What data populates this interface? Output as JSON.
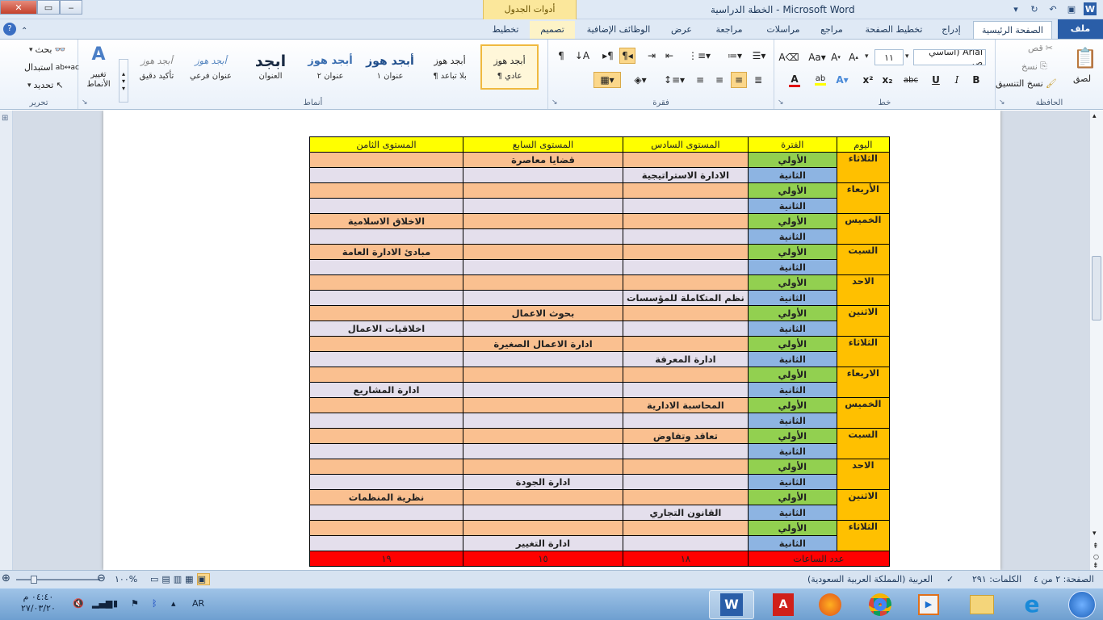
{
  "window": {
    "title": "الخطة الدراسية  -  Microsoft Word",
    "contextual_group": "أدوات الجدول",
    "buttons": {
      "close": "✕",
      "maximize": "▭",
      "minimize": "‒"
    }
  },
  "tabs": {
    "file": "ملف",
    "home": "الصفحة الرئيسية",
    "insert": "إدراج",
    "page_layout": "تخطيط الصفحة",
    "references": "مراجع",
    "mailings": "مراسلات",
    "review": "مراجعة",
    "view": "عرض",
    "addins": "الوظائف الإضافية",
    "design": "تصميم",
    "layout": "تخطيط"
  },
  "ribbon": {
    "clipboard": {
      "label": "الحافظة",
      "paste": "لصق",
      "cut": "قص",
      "copy": "نسخ",
      "format_painter": "نسخ التنسيق"
    },
    "font": {
      "label": "خط",
      "font_name": "Arial (أساسي ص",
      "font_size": "١١",
      "bold": "B",
      "italic": "I",
      "underline": "U",
      "strike": "abc",
      "sub": "x₂",
      "sup": "x²",
      "font_color": "#e00000",
      "highlight_color": "#ffff00"
    },
    "paragraph": {
      "label": "فقرة"
    },
    "styles": {
      "label": "أنماط",
      "items": [
        {
          "sample": "أبجد هوز",
          "name": "¶ عادي"
        },
        {
          "sample": "أبجد هوز",
          "name": "¶ بلا تباعد"
        },
        {
          "sample": "أبجد هوز",
          "name": "عنوان ١"
        },
        {
          "sample": "أبجد هوز",
          "name": "عنوان ٢"
        },
        {
          "sample": "ابجد",
          "name": "العنوان"
        },
        {
          "sample": "أبجد هوز",
          "name": "عنوان فرعي"
        },
        {
          "sample": "أبجد هوز",
          "name": "تأكيد دقيق"
        }
      ],
      "change_styles": "تغيير الأنماط"
    },
    "editing": {
      "label": "تحرير",
      "find": "بحث",
      "replace": "استبدال",
      "select": "تحديد"
    }
  },
  "table": {
    "headers": [
      "اليوم",
      "الفترة",
      "المستوى السادس",
      "المستوى السابع",
      "المستوى الثامن"
    ],
    "days": [
      {
        "day": "الثلاثاء",
        "rows": [
          [
            "الأولي",
            "",
            "قضايا معاصرة",
            ""
          ],
          [
            "الثانية",
            "الادارة الاستراتيجية",
            "",
            ""
          ]
        ]
      },
      {
        "day": "الأربعاء",
        "rows": [
          [
            "الأولي",
            "",
            "",
            ""
          ],
          [
            "الثانية",
            "",
            "",
            ""
          ]
        ]
      },
      {
        "day": "الخميس",
        "rows": [
          [
            "الأولي",
            "",
            "",
            "الاخلاق الاسلامية"
          ],
          [
            "الثانية",
            "",
            "",
            ""
          ]
        ]
      },
      {
        "day": "السبت",
        "rows": [
          [
            "الأولي",
            "",
            "",
            "مبادئ الادارة العامة"
          ],
          [
            "الثانية",
            "",
            "",
            ""
          ]
        ]
      },
      {
        "day": "الاحد",
        "rows": [
          [
            "الأولي",
            "",
            "",
            ""
          ],
          [
            "الثانية",
            "نظم المتكاملة للمؤسسات",
            "",
            ""
          ]
        ]
      },
      {
        "day": "الاثنين",
        "rows": [
          [
            "الأولي",
            "",
            "بحوث الاعمال",
            ""
          ],
          [
            "الثانية",
            "",
            "",
            "اخلاقيات الاعمال"
          ]
        ]
      },
      {
        "day": "الثلاثاء",
        "rows": [
          [
            "الأولي",
            "",
            "ادارة الاعمال الصغيرة",
            ""
          ],
          [
            "الثانية",
            "ادارة المعرفة",
            "",
            ""
          ]
        ]
      },
      {
        "day": "الاربعاء",
        "rows": [
          [
            "الأولي",
            "",
            "",
            ""
          ],
          [
            "الثانية",
            "",
            "",
            "ادارة المشاريع"
          ]
        ]
      },
      {
        "day": "الخميس",
        "rows": [
          [
            "الأولي",
            "المحاسبة الادارية",
            "",
            ""
          ],
          [
            "الثانية",
            "",
            "",
            ""
          ]
        ]
      },
      {
        "day": "السبت",
        "rows": [
          [
            "الأولي",
            "تعاقد وتفاوض",
            "",
            ""
          ],
          [
            "الثانية",
            "",
            "",
            ""
          ]
        ]
      },
      {
        "day": "الاحد",
        "rows": [
          [
            "الأولي",
            "",
            "",
            ""
          ],
          [
            "الثانية",
            "",
            "ادارة الجودة",
            ""
          ]
        ]
      },
      {
        "day": "الاثنين",
        "rows": [
          [
            "الأولي",
            "",
            "",
            "نظرية المنظمات"
          ],
          [
            "الثانية",
            "القانون التجاري",
            "",
            ""
          ]
        ]
      },
      {
        "day": "الثلاثاء",
        "rows": [
          [
            "الأولي",
            "",
            "",
            ""
          ],
          [
            "الثانية",
            "",
            "ادارة التغيير",
            ""
          ]
        ]
      }
    ],
    "totals": {
      "label": "عدد الساعات",
      "values": [
        "١٨",
        "١٥",
        "١٩"
      ]
    }
  },
  "statusbar": {
    "page": "الصفحة: ٢ من ٤",
    "words": "الكلمات: ٢٩١",
    "language": "العربية (المملكة العربية السعودية)",
    "zoom": "١٠٠%",
    "zoom_value": 100
  },
  "taskbar": {
    "lang": "AR",
    "time": "٠٤:٤٠ م",
    "date": "٢٧/٠٣/٢٠"
  },
  "colors": {
    "day": "#ffc000",
    "header": "#ffff00",
    "period_first": "#92d050",
    "period_second": "#8db4e2",
    "row_first": "#fac090",
    "row_second": "#e4dfec",
    "totals": "#ff0000"
  }
}
